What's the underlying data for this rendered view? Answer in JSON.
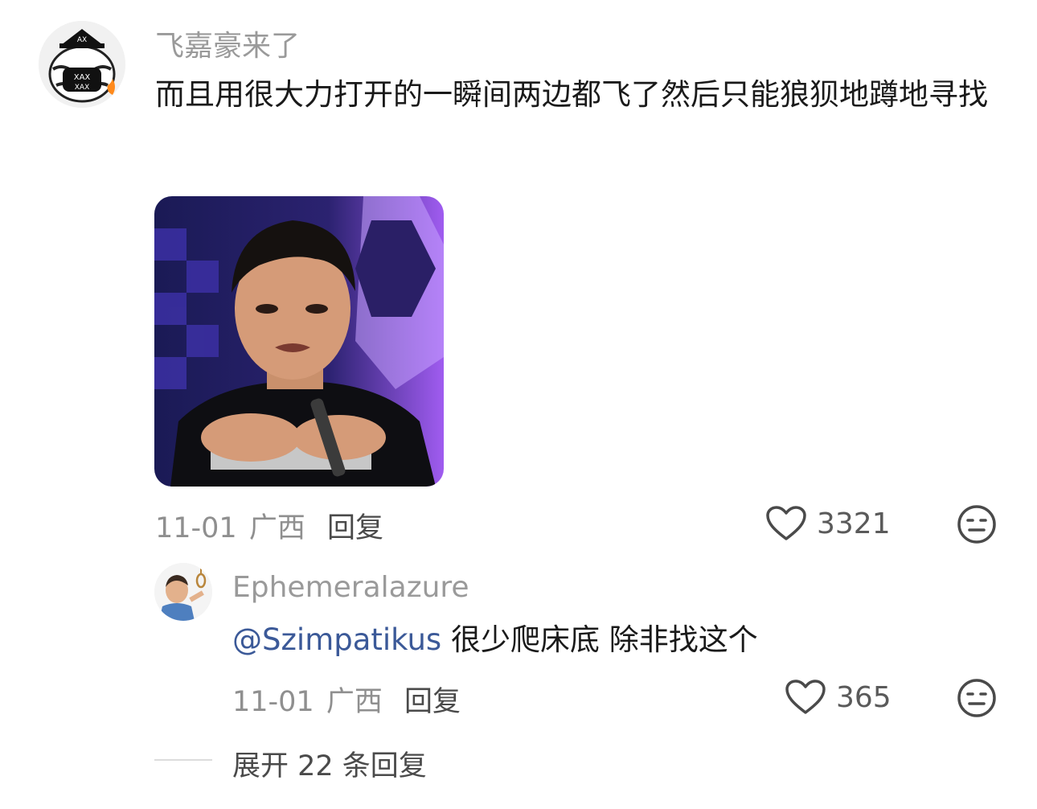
{
  "comment": {
    "username": "飞嘉豪来了",
    "text": "而且用很大力打开的一瞬间两边都飞了然后只能狼狈地蹲地寻找",
    "date": "11-01",
    "location": "广西",
    "reply_label": "回复",
    "likes": "3321",
    "like_icon": "heart-outline-icon",
    "dislike_icon": "meh-face-icon"
  },
  "reply": {
    "username": "Ephemeralazure",
    "mention": "@Szimpatikus",
    "text": " 很少爬床底 除非找这个",
    "date": "11-01",
    "location": "广西",
    "reply_label": "回复",
    "likes": "365"
  },
  "expand": {
    "label": "展开 22 条回复"
  },
  "colors": {
    "mention": "#3b5998",
    "muted": "#9a9a9a",
    "text": "#1a1a1a"
  }
}
